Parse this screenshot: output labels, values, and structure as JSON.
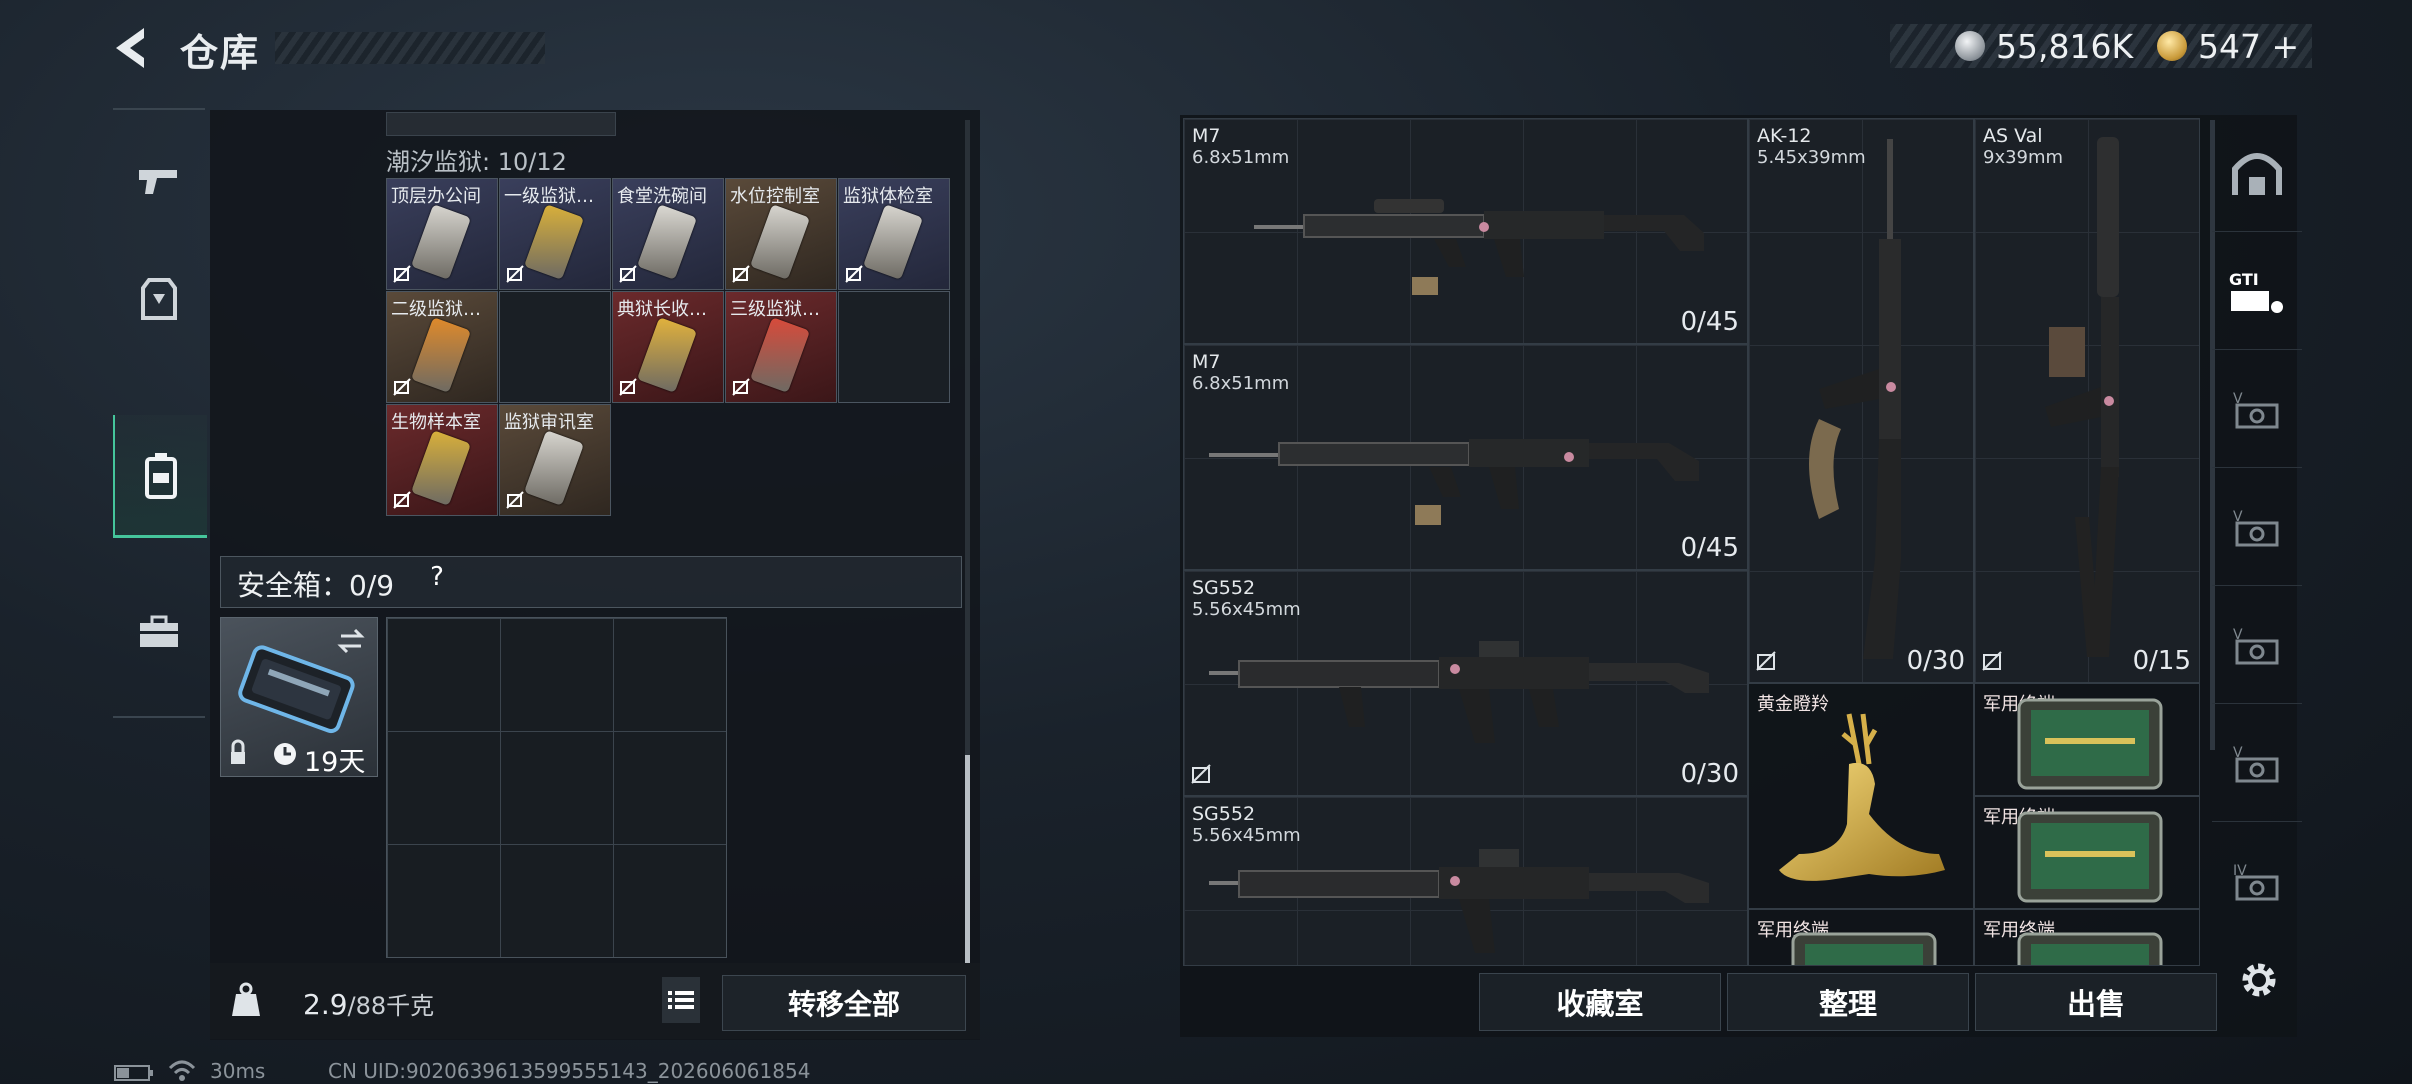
{
  "header": {
    "title": "仓库"
  },
  "currency": {
    "silver": "55,816K",
    "gold": "547",
    "gold_plus": "+"
  },
  "stash": {
    "region_label": "潮汐监狱: 10/12",
    "keycards": [
      {
        "name": "顶层办公间",
        "bg": "navy",
        "card_color": "#d8d6d0"
      },
      {
        "name": "一级监狱…",
        "bg": "navy",
        "card_color": "#d9b03a"
      },
      {
        "name": "食堂洗碗间",
        "bg": "navy",
        "card_color": "#dcdad4"
      },
      {
        "name": "水位控制室",
        "bg": "brown",
        "card_color": "#d8d6d0"
      },
      {
        "name": "监狱体检室",
        "bg": "navy",
        "card_color": "#d8d6d0"
      },
      {
        "name": "二级监狱…",
        "bg": "brown",
        "card_color": "#e08a2a"
      },
      {
        "name": "",
        "bg": "empty",
        "card_color": ""
      },
      {
        "name": "典狱长收…",
        "bg": "red",
        "card_color": "#e2b23c"
      },
      {
        "name": "三级监狱…",
        "bg": "red",
        "card_color": "#d84a3a"
      },
      {
        "name": "",
        "bg": "empty",
        "card_color": ""
      },
      {
        "name": "生物样本室",
        "bg": "red",
        "card_color": "#d9b03a"
      },
      {
        "name": "监狱审讯室",
        "bg": "brown",
        "card_color": "#d8d6d0"
      }
    ]
  },
  "safebox": {
    "label": "安全箱：0/9",
    "help": "?",
    "item_days": "19天"
  },
  "weight": {
    "current": "2.9",
    "capacity": "/88千克"
  },
  "buttons": {
    "transfer_all": "转移全部",
    "collection": "收藏室",
    "organize": "整理",
    "sell": "出售"
  },
  "inventory": {
    "weapons": [
      {
        "name": "M7",
        "caliber": "6.8x51mm",
        "count": "0/45"
      },
      {
        "name": "M7",
        "caliber": "6.8x51mm",
        "count": "0/45"
      },
      {
        "name": "SG552",
        "caliber": "5.56x45mm",
        "count": "0/30"
      },
      {
        "name": "SG552",
        "caliber": "5.56x45mm",
        "count": ""
      },
      {
        "name": "AK-12",
        "caliber": "5.45x39mm",
        "count": "0/30"
      },
      {
        "name": "AS Val",
        "caliber": "9x39mm",
        "count": "0/15"
      }
    ],
    "treasures": [
      {
        "name": "黄金瞪羚"
      },
      {
        "name": "军用终端"
      },
      {
        "name": "军用终端"
      },
      {
        "name": "军用终端"
      },
      {
        "name": "军用终端"
      }
    ]
  },
  "status": {
    "ping": "30ms",
    "uid": "CN UID:9020639613599555143_202606061854"
  },
  "icons": {
    "nav": [
      "pistol-icon",
      "armor-icon",
      "backpack-icon",
      "toolbox-icon"
    ],
    "side": [
      "collection-room-icon",
      "gti-icon",
      "tier-v-icon",
      "tier-v-icon",
      "tier-v-icon",
      "tier-v-icon",
      "tier-iv-icon"
    ]
  },
  "colors": {
    "accent": "#45c59b",
    "maroon": "#5c2228"
  }
}
